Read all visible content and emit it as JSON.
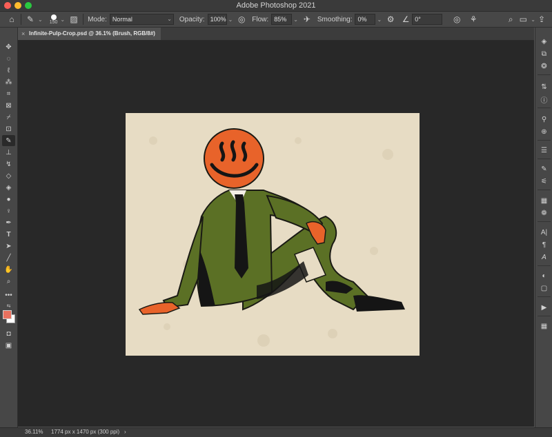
{
  "window": {
    "title": "Adobe Photoshop 2021"
  },
  "options_bar": {
    "brush_size": "150",
    "mode_label": "Mode:",
    "mode_value": "Normal",
    "opacity_label": "Opacity:",
    "opacity_value": "100%",
    "flow_label": "Flow:",
    "flow_value": "85%",
    "smoothing_label": "Smoothing:",
    "smoothing_value": "0%",
    "angle_value": "0°"
  },
  "document_tab": {
    "close": "×",
    "title": "Infinite-Pulp-Crop.psd @ 36.1% (Brush, RGB/8#)"
  },
  "status": {
    "zoom": "36.11%",
    "doc_info": "1774 px x 1470 px (300 ppi)",
    "arrow": "›"
  },
  "colors": {
    "foreground": "#e8715f",
    "background": "#ffffff",
    "paper": "#e7dcc4",
    "suit": "#5b7025",
    "face": "#e8632a"
  },
  "icons": {
    "tools": [
      "move-icon",
      "marquee-icon",
      "lasso-icon",
      "magic-wand-icon",
      "crop-icon",
      "frame-icon",
      "eyedropper-icon",
      "healing-icon",
      "brush-icon",
      "stamp-icon",
      "history-brush-icon",
      "eraser-icon",
      "bucket-icon",
      "blur-icon",
      "dodge-icon",
      "pen-icon",
      "type-icon",
      "path-select-icon",
      "line-icon",
      "hand-icon",
      "zoom-icon",
      "more-icon"
    ],
    "panels": [
      "layers-icon",
      "channels-icon",
      "paths-icon",
      "adjustments-icon",
      "info-icon",
      "brushes-icon",
      "clone-source-icon",
      "properties-icon",
      "tool-presets-icon",
      "brush-settings-icon",
      "swatches-icon",
      "styles-icon",
      "character-icon",
      "paragraph-icon",
      "glyphs-icon",
      "color-icon",
      "notes-icon",
      "actions-icon",
      "libraries-icon"
    ]
  }
}
